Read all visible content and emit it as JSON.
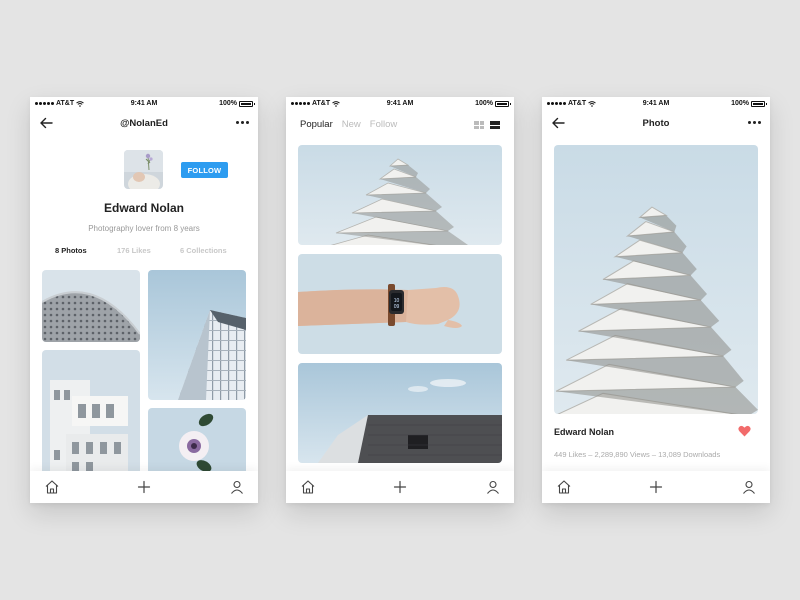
{
  "status_bar": {
    "carrier": "AT&T",
    "time": "9:41 AM",
    "battery": "100%"
  },
  "profile_screen": {
    "title": "@NolanEd",
    "follow_label": "FOLLOW",
    "name": "Edward Nolan",
    "bio": "Photography lover from 8 years",
    "stats": {
      "photos": "8 Photos",
      "likes": "176 Likes",
      "collections": "6 Collections"
    }
  },
  "feed_screen": {
    "tabs": [
      "Popular",
      "New",
      "Follow"
    ],
    "active_tab": "Popular"
  },
  "photo_screen": {
    "title": "Photo",
    "author": "Edward Nolan",
    "stats": "449 Likes – 2,289,890 Views – 13,089 Downloads"
  },
  "tab_bar": {
    "icons": [
      "home-icon",
      "add-icon",
      "profile-icon"
    ]
  },
  "colors": {
    "accent": "#2d9cf0",
    "heart": "#f26b6b",
    "sky": "#cfdfe8",
    "background": "#e4e4e4"
  }
}
